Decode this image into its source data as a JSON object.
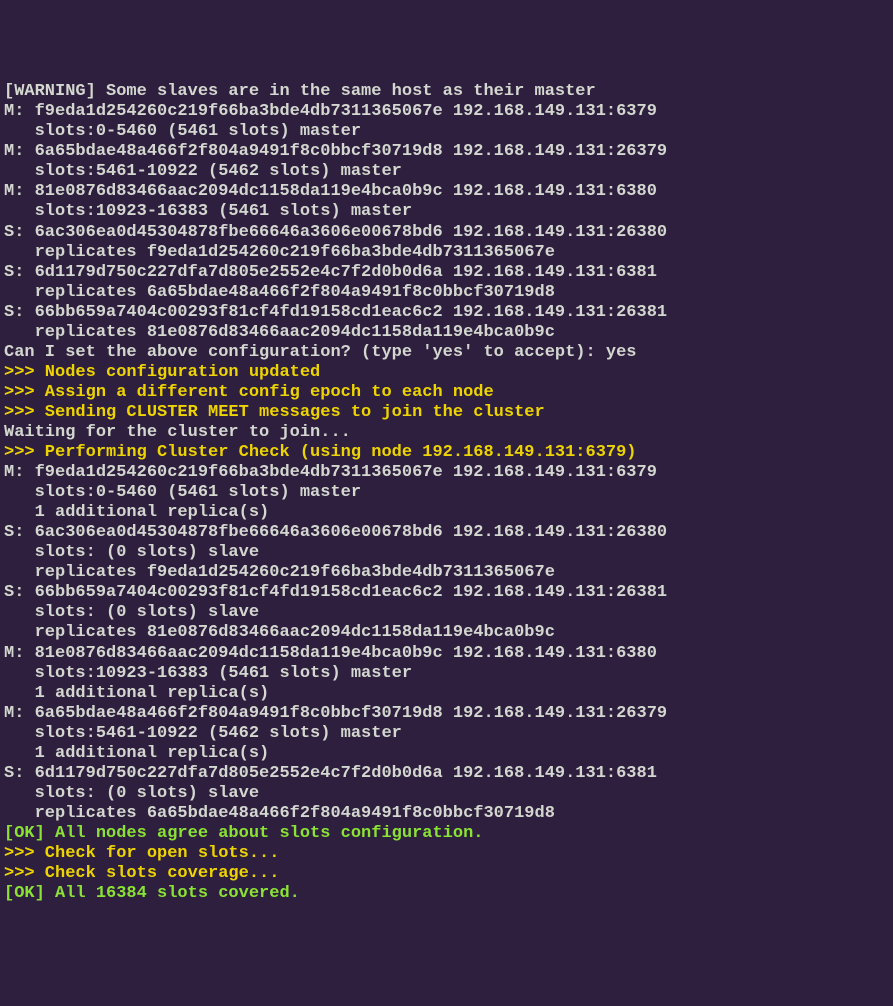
{
  "lines": [
    {
      "text": "[WARNING] Some slaves are in the same host as their master",
      "class": "normal"
    },
    {
      "text": "M: f9eda1d254260c219f66ba3bde4db7311365067e 192.168.149.131:6379",
      "class": "normal"
    },
    {
      "text": "   slots:0-5460 (5461 slots) master",
      "class": "normal"
    },
    {
      "text": "M: 6a65bdae48a466f2f804a9491f8c0bbcf30719d8 192.168.149.131:26379",
      "class": "normal"
    },
    {
      "text": "   slots:5461-10922 (5462 slots) master",
      "class": "normal"
    },
    {
      "text": "M: 81e0876d83466aac2094dc1158da119e4bca0b9c 192.168.149.131:6380",
      "class": "normal"
    },
    {
      "text": "   slots:10923-16383 (5461 slots) master",
      "class": "normal"
    },
    {
      "text": "S: 6ac306ea0d45304878fbe66646a3606e00678bd6 192.168.149.131:26380",
      "class": "normal"
    },
    {
      "text": "   replicates f9eda1d254260c219f66ba3bde4db7311365067e",
      "class": "normal"
    },
    {
      "text": "S: 6d1179d750c227dfa7d805e2552e4c7f2d0b0d6a 192.168.149.131:6381",
      "class": "normal"
    },
    {
      "text": "   replicates 6a65bdae48a466f2f804a9491f8c0bbcf30719d8",
      "class": "normal"
    },
    {
      "text": "S: 66bb659a7404c00293f81cf4fd19158cd1eac6c2 192.168.149.131:26381",
      "class": "normal"
    },
    {
      "text": "   replicates 81e0876d83466aac2094dc1158da119e4bca0b9c",
      "class": "normal"
    },
    {
      "text": "Can I set the above configuration? (type 'yes' to accept): yes",
      "class": "normal"
    },
    {
      "text": ">>> Nodes configuration updated",
      "class": "yellow-bold"
    },
    {
      "text": ">>> Assign a different config epoch to each node",
      "class": "yellow-bold"
    },
    {
      "text": ">>> Sending CLUSTER MEET messages to join the cluster",
      "class": "yellow-bold"
    },
    {
      "text": "Waiting for the cluster to join...",
      "class": "normal"
    },
    {
      "text": ">>> Performing Cluster Check (using node 192.168.149.131:6379)",
      "class": "yellow-bold"
    },
    {
      "text": "M: f9eda1d254260c219f66ba3bde4db7311365067e 192.168.149.131:6379",
      "class": "normal"
    },
    {
      "text": "   slots:0-5460 (5461 slots) master",
      "class": "normal"
    },
    {
      "text": "   1 additional replica(s)",
      "class": "normal"
    },
    {
      "text": "S: 6ac306ea0d45304878fbe66646a3606e00678bd6 192.168.149.131:26380",
      "class": "normal"
    },
    {
      "text": "   slots: (0 slots) slave",
      "class": "normal"
    },
    {
      "text": "   replicates f9eda1d254260c219f66ba3bde4db7311365067e",
      "class": "normal"
    },
    {
      "text": "S: 66bb659a7404c00293f81cf4fd19158cd1eac6c2 192.168.149.131:26381",
      "class": "normal"
    },
    {
      "text": "   slots: (0 slots) slave",
      "class": "normal"
    },
    {
      "text": "   replicates 81e0876d83466aac2094dc1158da119e4bca0b9c",
      "class": "normal"
    },
    {
      "text": "M: 81e0876d83466aac2094dc1158da119e4bca0b9c 192.168.149.131:6380",
      "class": "normal"
    },
    {
      "text": "   slots:10923-16383 (5461 slots) master",
      "class": "normal"
    },
    {
      "text": "   1 additional replica(s)",
      "class": "normal"
    },
    {
      "text": "M: 6a65bdae48a466f2f804a9491f8c0bbcf30719d8 192.168.149.131:26379",
      "class": "normal"
    },
    {
      "text": "   slots:5461-10922 (5462 slots) master",
      "class": "normal"
    },
    {
      "text": "   1 additional replica(s)",
      "class": "normal"
    },
    {
      "text": "S: 6d1179d750c227dfa7d805e2552e4c7f2d0b0d6a 192.168.149.131:6381",
      "class": "normal"
    },
    {
      "text": "   slots: (0 slots) slave",
      "class": "normal"
    },
    {
      "text": "   replicates 6a65bdae48a466f2f804a9491f8c0bbcf30719d8",
      "class": "normal"
    },
    {
      "text": "[OK] All nodes agree about slots configuration.",
      "class": "green"
    },
    {
      "text": ">>> Check for open slots...",
      "class": "yellow-bold"
    },
    {
      "text": ">>> Check slots coverage...",
      "class": "yellow-bold"
    },
    {
      "text": "[OK] All 16384 slots covered.",
      "class": "green"
    }
  ]
}
